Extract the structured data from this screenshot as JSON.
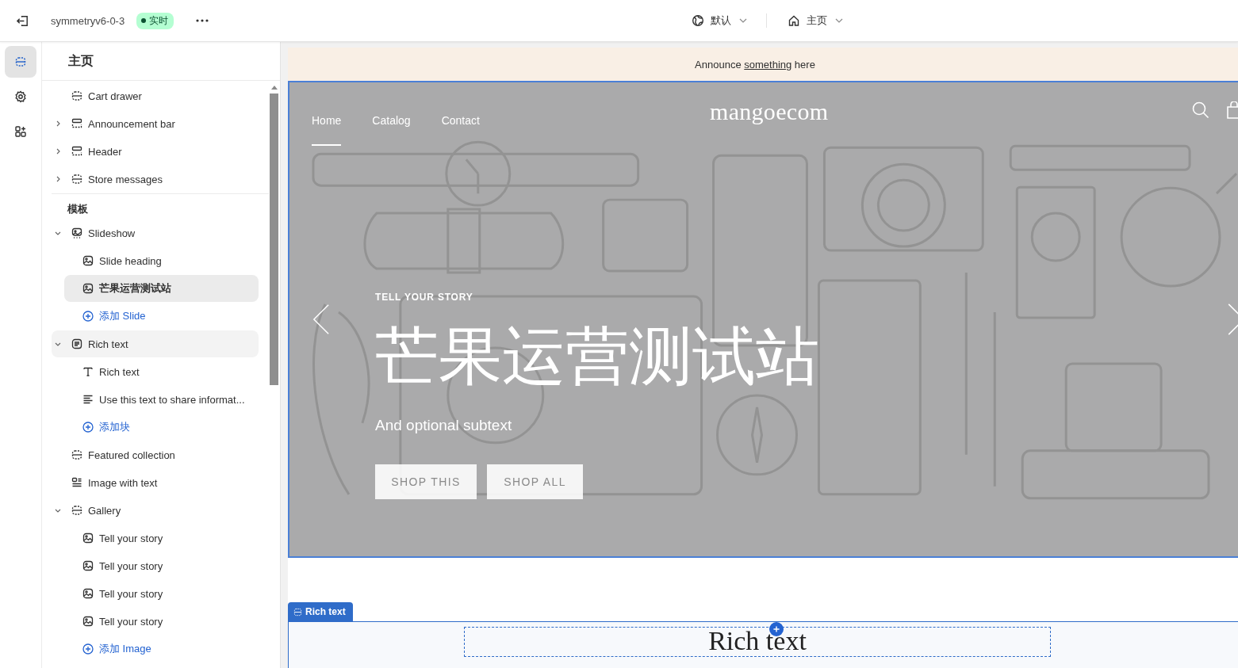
{
  "topbar": {
    "store_name": "symmetryv6-0-3",
    "status": {
      "label": "实时",
      "live": true
    },
    "theme_menu": {
      "label": "默认"
    },
    "page_menu": {
      "label": "主页"
    }
  },
  "rail": [
    {
      "kind": "sections",
      "selected": true
    },
    {
      "kind": "settings",
      "selected": false
    },
    {
      "kind": "apps",
      "selected": false
    }
  ],
  "sidebar": {
    "title": "主页",
    "groups": [
      {
        "items": [
          {
            "label": "Cart drawer",
            "kind": "section",
            "selected": false,
            "hovered": false
          },
          {
            "label": "Announcement bar",
            "kind": "header",
            "selected": false,
            "hovered": false,
            "expanded": false
          },
          {
            "label": "Header",
            "kind": "header",
            "selected": false,
            "hovered": false,
            "expanded": false
          },
          {
            "label": "Store messages",
            "kind": "section",
            "selected": false,
            "hovered": false,
            "expanded": false
          }
        ]
      },
      {
        "title": "模板",
        "items": [
          {
            "label": "Slideshow",
            "kind": "slideshow",
            "selected": false,
            "hovered": false,
            "expanded": true,
            "children": [
              {
                "label": "Slide heading",
                "kind": "image",
                "selected": false
              },
              {
                "label": "芒果运营测试站",
                "kind": "image",
                "selected": true
              },
              {
                "label": "添加 Slide",
                "kind": "add",
                "selected": false
              }
            ]
          },
          {
            "label": "Rich text",
            "kind": "richtext",
            "selected": false,
            "hovered": true,
            "expanded": true,
            "children": [
              {
                "label": "Rich text",
                "kind": "text",
                "selected": false
              },
              {
                "label": "Use this text to share informat...",
                "kind": "paragraph",
                "selected": false
              },
              {
                "label": "添加块",
                "kind": "add",
                "selected": false
              }
            ]
          },
          {
            "label": "Featured collection",
            "kind": "section",
            "selected": false,
            "hovered": false
          },
          {
            "label": "Image with text",
            "kind": "imagetext",
            "selected": false,
            "hovered": false
          },
          {
            "label": "Gallery",
            "kind": "section",
            "selected": false,
            "hovered": false,
            "expanded": true,
            "children": [
              {
                "label": "Tell your story",
                "kind": "image",
                "selected": false
              },
              {
                "label": "Tell your story",
                "kind": "image",
                "selected": false
              },
              {
                "label": "Tell your story",
                "kind": "image",
                "selected": false
              },
              {
                "label": "Tell your story",
                "kind": "image",
                "selected": false
              },
              {
                "label": "添加 Image",
                "kind": "add",
                "selected": false
              }
            ]
          }
        ]
      }
    ]
  },
  "preview": {
    "announcement": {
      "before": "Announce ",
      "link": "something",
      "after": " here"
    },
    "hero": {
      "selected": true,
      "nav": [
        {
          "label": "Home",
          "selected": true
        },
        {
          "label": "Catalog",
          "selected": false
        },
        {
          "label": "Contact",
          "selected": false
        }
      ],
      "logo": "mangoecom",
      "kicker": "TELL YOUR STORY",
      "heading": "芒果运营测试站",
      "subtext": "And optional subtext",
      "buttons": [
        "SHOP THIS",
        "SHOP ALL"
      ]
    },
    "rich_text": {
      "tag": "Rich text",
      "heading": "Rich text",
      "selected": true
    }
  }
}
